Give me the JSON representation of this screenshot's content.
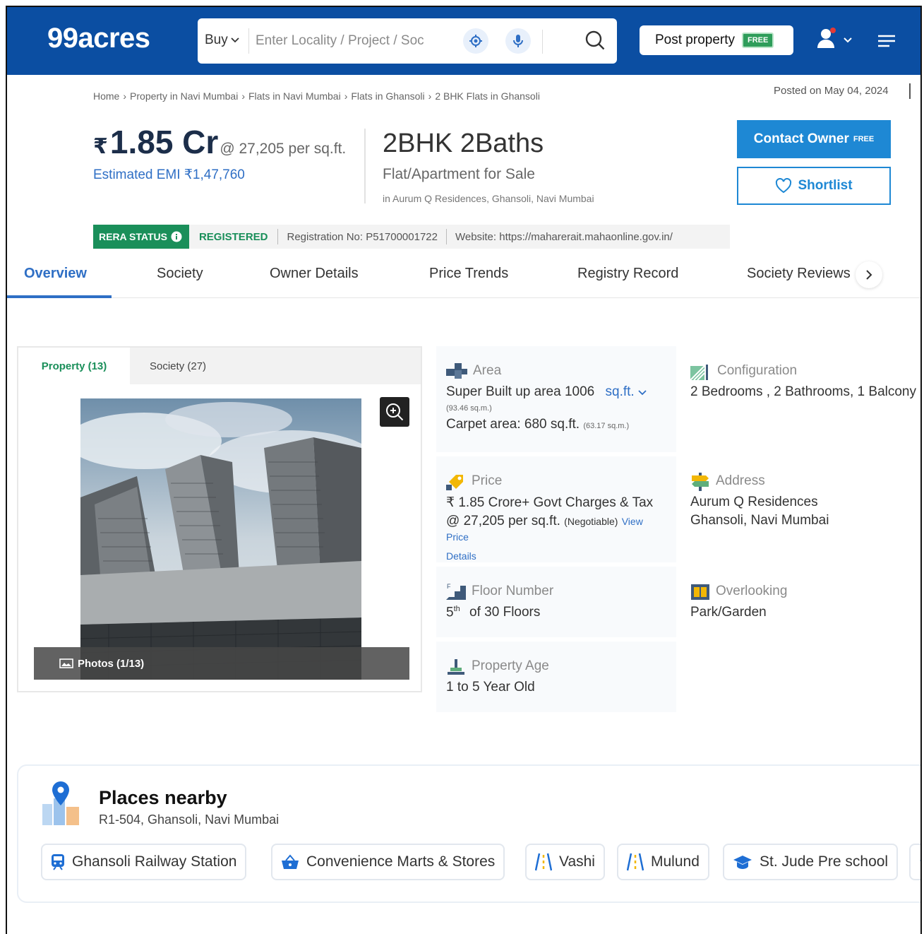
{
  "header": {
    "logo": "99acres",
    "buy_label": "Buy",
    "search_placeholder": "Enter Locality / Project / Soc",
    "post_property_label": "Post property",
    "free_tag": "FREE"
  },
  "breadcrumb": [
    "Home",
    "Property in Navi Mumbai",
    "Flats in Navi Mumbai",
    "Flats in Ghansoli",
    "2 BHK Flats in Ghansoli"
  ],
  "posted_on": "Posted on May 04, 2024",
  "listing": {
    "rupee": "₹",
    "price": "1.85 Cr",
    "price_per_sqft": "@ 27,205 per sq.ft.",
    "emi": "Estimated EMI ₹1,47,760",
    "config_title": "2BHK 2Baths",
    "config_sub": "Flat/Apartment for Sale",
    "location": "in Aurum Q Residences, Ghansoli, Navi Mumbai"
  },
  "actions": {
    "contact_label": "Contact Owner",
    "contact_tag": "FREE",
    "shortlist_label": "Shortlist"
  },
  "rera": {
    "status_label": "RERA STATUS",
    "status_value": "REGISTERED",
    "registration": "Registration No: P51700001722",
    "website": "Website: https://maharerait.mahaonline.gov.in/"
  },
  "tabs": [
    "Overview",
    "Society",
    "Owner Details",
    "Price Trends",
    "Registry Record",
    "Society Reviews"
  ],
  "gallery": {
    "tab_property": "Property (13)",
    "tab_society": "Society (27)",
    "photo_counter": "Photos (1/13)"
  },
  "details": {
    "area_label": "Area",
    "area_value": "Super Built up area 1006",
    "area_unit": "sq.ft.",
    "area_sqm": "(93.46 sq.m.)",
    "carpet_value": "Carpet area: 680 sq.ft.",
    "carpet_sqm": "(63.17 sq.m.)",
    "config_label": "Configuration",
    "config_value": "2 Bedrooms , 2 Bathrooms, 1 Balcony",
    "price_label": "Price",
    "price_value": "₹ 1.85 Crore+ Govt Charges & Tax",
    "price_sqft": "@ 27,205 per sq.ft.",
    "negotiable": "(Negotiable)",
    "view_price": "View Price",
    "details_link": "Details",
    "address_label": "Address",
    "address_line1": "Aurum Q Residences",
    "address_line2": "Ghansoli, Navi Mumbai",
    "floor_label": "Floor Number",
    "floor_num": "5",
    "floor_sup": "th",
    "floor_total": "of 30 Floors",
    "overlooking_label": "Overlooking",
    "overlooking_value": "Park/Garden",
    "age_label": "Property Age",
    "age_value": "1 to 5 Year Old"
  },
  "places": {
    "title": "Places nearby",
    "address": "R1-504, Ghansoli, Navi Mumbai",
    "chips": [
      "Ghansoli Railway Station",
      "Convenience Marts & Stores",
      "Vashi",
      "Mulund",
      "St. Jude Pre school"
    ]
  },
  "colors": {
    "brand": "#0b4ea2",
    "accent": "#1e88d4",
    "link": "#2f6fc5",
    "rera_green": "#1a8f5a"
  }
}
